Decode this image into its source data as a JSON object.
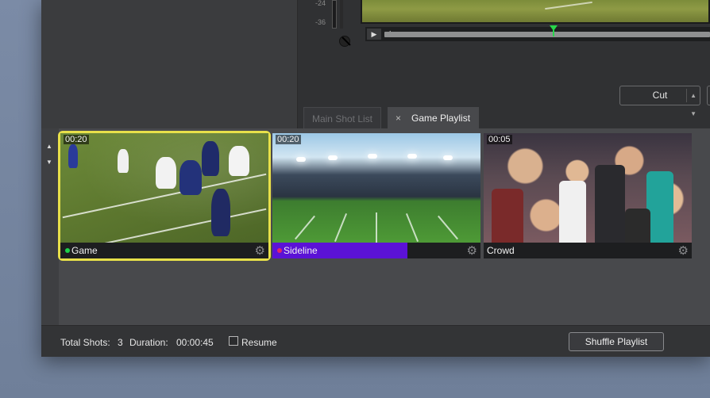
{
  "meter": {
    "label_minus24": "-24",
    "label_minus36": "-36"
  },
  "transition": {
    "selected": "Cut"
  },
  "tabs": [
    {
      "label": "Main Shot List",
      "active": false
    },
    {
      "label": "Game Playlist",
      "active": true
    }
  ],
  "tab_close_glyph": "×",
  "shots": [
    {
      "name": "Game",
      "duration": "00:20",
      "status_color": "#1fd14a",
      "label_bg": "#1d1e20",
      "selected": true
    },
    {
      "name": "Sideline",
      "duration": "00:20",
      "status_color": "#e0246a",
      "label_bg": "#5b12d6",
      "label_fill_fraction": 0.65,
      "selected": false
    },
    {
      "name": "Crowd",
      "duration": "00:05",
      "status_color": "",
      "label_bg": "#1d1e20",
      "selected": false
    }
  ],
  "footer": {
    "total_shots_label": "Total Shots:",
    "total_shots_value": "3",
    "duration_label": "Duration:",
    "duration_value": "00:00:45",
    "resume_label": "Resume",
    "resume_checked": false,
    "shuffle_label": "Shuffle Playlist"
  },
  "icons": {
    "play": "▶",
    "scrub_start": "◢",
    "dropdown": "▲▼",
    "up": "▲",
    "down": "▼",
    "gear": "⚙"
  },
  "colors": {
    "selection_outline": "#e8e04a",
    "playhead": "#27d64a"
  }
}
